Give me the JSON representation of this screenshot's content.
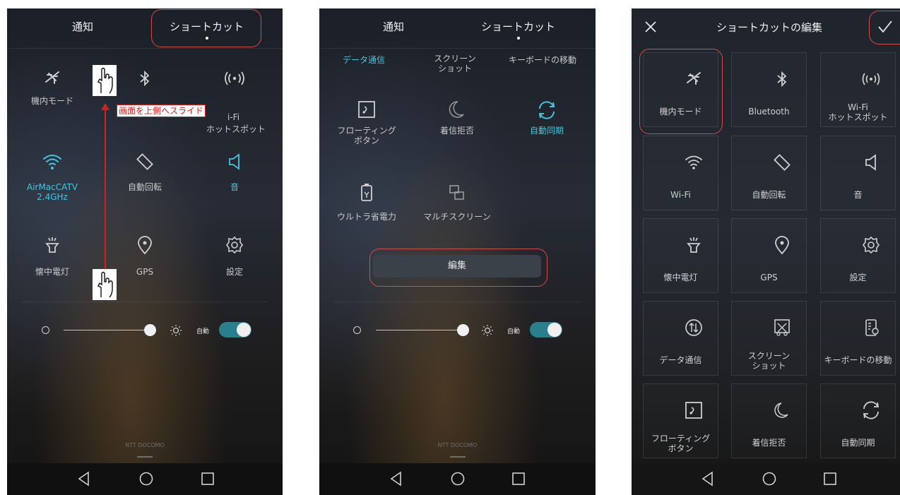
{
  "panel1": {
    "tabs": [
      "通知",
      "ショートカット"
    ],
    "tiles": [
      {
        "icon": "airplane-icon",
        "label": "機内モード"
      },
      {
        "icon": "bluetooth-icon",
        "label": ""
      },
      {
        "icon": "hotspot-icon",
        "label": "Wi-Fi ホットスポット"
      },
      {
        "icon": "wifi-icon",
        "label": "AirMacCATV 2.4GHz",
        "active": true
      },
      {
        "icon": "rotate-icon",
        "label": "自動回転"
      },
      {
        "icon": "sound-icon",
        "label": "音",
        "active": true
      },
      {
        "icon": "flashlight-icon",
        "label": "懐中電灯"
      },
      {
        "icon": "location-icon",
        "label": "GPS"
      },
      {
        "icon": "settings-icon",
        "label": "設定"
      }
    ],
    "annotation": "画面を上側へスライド",
    "hotspot_label_visible_1": "i-Fi",
    "hotspot_label_visible_2": "ホットスポット",
    "brightness": {
      "auto_label": "自動",
      "level": 0.91
    },
    "carrier": "NTT DOCOMO"
  },
  "panel2": {
    "tabs": [
      "通知",
      "ショートカット"
    ],
    "tiles": [
      {
        "icon": "data-icon",
        "label": "データ通信",
        "active": true
      },
      {
        "icon": "screenshot-icon",
        "label": "スクリーン ショット"
      },
      {
        "icon": "keyboard-icon",
        "label": "キーボードの移動"
      },
      {
        "icon": "floating-button-icon",
        "label": "フローティング ボタン"
      },
      {
        "icon": "moon-icon",
        "label": "着信拒否"
      },
      {
        "icon": "sync-icon",
        "label": "自動同期",
        "active": true
      },
      {
        "icon": "battery-icon",
        "label": "ウルトラ省電力"
      },
      {
        "icon": "multiscreen-icon",
        "label": "マルチスクリーン"
      }
    ],
    "edit_button": "編集",
    "brightness": {
      "auto_label": "自動",
      "level": 0.91
    },
    "carrier": "NTT DOCOMO"
  },
  "panel3": {
    "title": "ショートカットの編集",
    "cells": [
      {
        "icon": "airplane-icon",
        "label": "機内モード"
      },
      {
        "icon": "bluetooth-icon",
        "label": "Bluetooth"
      },
      {
        "icon": "hotspot-icon",
        "label": "Wi-Fi ホットスポット"
      },
      {
        "icon": "wifi-icon",
        "label": "Wi-Fi"
      },
      {
        "icon": "rotate-icon",
        "label": "自動回転"
      },
      {
        "icon": "sound-icon",
        "label": "音"
      },
      {
        "icon": "flashlight-icon",
        "label": "懐中電灯"
      },
      {
        "icon": "location-icon",
        "label": "GPS"
      },
      {
        "icon": "settings-icon",
        "label": "設定"
      },
      {
        "icon": "data-icon",
        "label": "データ通信"
      },
      {
        "icon": "screenshot-icon",
        "label": "スクリーン ショット"
      },
      {
        "icon": "keyboard-icon",
        "label": "キーボードの移動"
      },
      {
        "icon": "floating-button-icon",
        "label": "フローティング ボタン"
      },
      {
        "icon": "moon-icon",
        "label": "着信拒否"
      },
      {
        "icon": "sync-icon",
        "label": "自動同期"
      }
    ]
  },
  "colors": {
    "accent": "#47c5dd",
    "annotation_red": "#d64b45"
  }
}
